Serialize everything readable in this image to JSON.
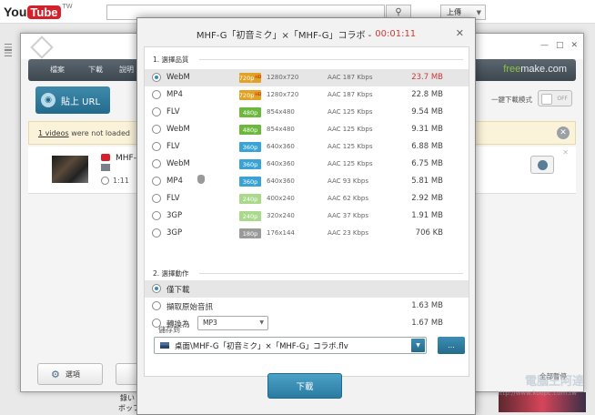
{
  "youtube": {
    "logo_you": "You",
    "logo_tube": "Tube",
    "region": "TW",
    "search_icon": "search-icon",
    "upload_label": "上傳"
  },
  "freemake": {
    "menu": [
      "檔案",
      "下載",
      "說明"
    ],
    "brand_free": "free",
    "brand_make": "make.com",
    "paste_url_label": "貼上 URL",
    "one_click_mode_label": "一鍵下載模式",
    "toggle_label": "OFF",
    "warning_count": "1 videos",
    "warning_rest": " were not loaded",
    "item_title": "MHF-",
    "item_duration": "1:11",
    "options_label": "選項",
    "autorun_label": "全部暫停"
  },
  "dialog": {
    "title": "MHF-G「初音ミク」×「MHF-G」コラボ - ",
    "duration": "00:01:11",
    "section1_label": "1. 選擇品質",
    "section2_label": "2. 選擇動作",
    "formats": [
      {
        "name": "WebM",
        "badge": "720p",
        "hd": "HD",
        "badge_color": "#e2a324",
        "res": "1280x720",
        "audio": "AAC 187  Kbps",
        "size": "23.7 MB",
        "selected": true
      },
      {
        "name": "MP4",
        "badge": "720p",
        "hd": "HD",
        "badge_color": "#e2a324",
        "res": "1280x720",
        "audio": "AAC 187  Kbps",
        "size": "22.8 MB",
        "selected": false
      },
      {
        "name": "FLV",
        "badge": "480p",
        "hd": "",
        "badge_color": "#6cb83d",
        "res": "854x480",
        "audio": "AAC 125  Kbps",
        "size": "9.54 MB",
        "selected": false
      },
      {
        "name": "WebM",
        "badge": "480p",
        "hd": "",
        "badge_color": "#6cb83d",
        "res": "854x480",
        "audio": "AAC 125  Kbps",
        "size": "9.31 MB",
        "selected": false
      },
      {
        "name": "FLV",
        "badge": "360p",
        "hd": "",
        "badge_color": "#39a3d6",
        "res": "640x360",
        "audio": "AAC 125  Kbps",
        "size": "6.88 MB",
        "selected": false
      },
      {
        "name": "WebM",
        "badge": "360p",
        "hd": "",
        "badge_color": "#39a3d6",
        "res": "640x360",
        "audio": "AAC 125  Kbps",
        "size": "6.75 MB",
        "selected": false
      },
      {
        "name": "MP4",
        "badge": "360p",
        "hd": "",
        "badge_color": "#39a3d6",
        "res": "640x360",
        "audio": "AAC 93  Kbps",
        "size": "5.81 MB",
        "selected": false,
        "apple": true
      },
      {
        "name": "FLV",
        "badge": "240p",
        "hd": "",
        "badge_color": "#a9d98a",
        "res": "400x240",
        "audio": "AAC 62  Kbps",
        "size": "2.92 MB",
        "selected": false
      },
      {
        "name": "3GP",
        "badge": "240p",
        "hd": "",
        "badge_color": "#a9d98a",
        "res": "320x240",
        "audio": "AAC 37  Kbps",
        "size": "1.91 MB",
        "selected": false
      },
      {
        "name": "3GP",
        "badge": "180p",
        "hd": "",
        "badge_color": "#9a9a9a",
        "res": "176x144",
        "audio": "AAC 23  Kbps",
        "size": "706 KB",
        "selected": false
      }
    ],
    "actions": [
      {
        "name": "僅下載",
        "size": "",
        "selected": true
      },
      {
        "name": "擷取原始音訊",
        "size": "1.63 MB",
        "selected": false
      },
      {
        "name": "轉換為",
        "size": "1.67 MB",
        "selected": false,
        "select_value": "MP3"
      }
    ],
    "save_to_label": "儲存到",
    "save_path": "桌面\\MHF-G「初音ミク」×「MHF-G」コラボ.flv",
    "browse_label": "...",
    "download_label": "下載"
  },
  "background": {
    "watermark": "電腦王阿達",
    "watermark_url": "http://www.koopc.com.tw",
    "below_text_1": "錄い",
    "below_text_2": "ボッフ"
  }
}
